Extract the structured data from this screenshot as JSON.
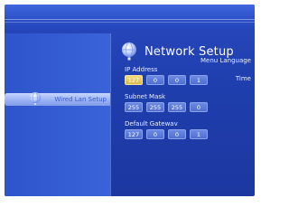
{
  "sidebar": {
    "items": [
      {
        "label": "Menu Language"
      },
      {
        "label": "Time"
      },
      {
        "label": "Wired Lan Setup",
        "selected": true
      }
    ]
  },
  "panel": {
    "title": "Network Setup",
    "ip": {
      "label": "IP Address",
      "octets": [
        "127",
        "0",
        "0",
        "1"
      ],
      "active_octet": 0
    },
    "mask": {
      "label": "Subnet Mask",
      "octets": [
        "255",
        "255",
        "255",
        "0"
      ]
    },
    "gateway": {
      "label": "Default Gatewav",
      "octets": [
        "127",
        "0",
        "0",
        "1"
      ]
    }
  },
  "icons": {
    "network": "globe-icon"
  },
  "colors": {
    "background": "#1f3fae",
    "highlight": "#d7b94a",
    "selection": "#9fb6f6"
  }
}
